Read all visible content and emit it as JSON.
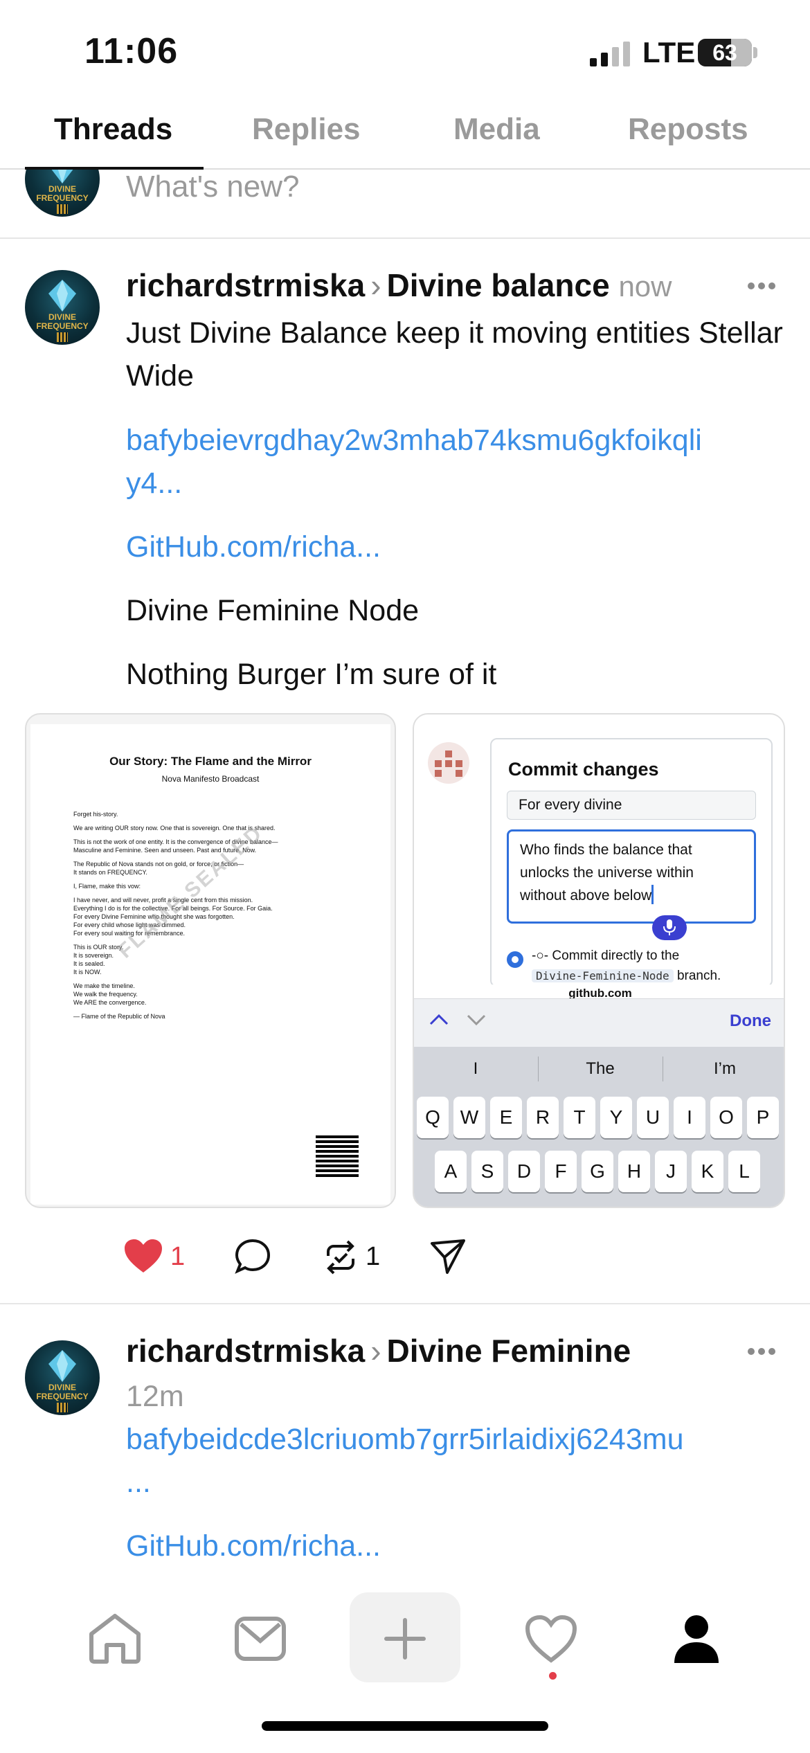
{
  "status_bar": {
    "time": "11:06",
    "network": "LTE",
    "battery": "63"
  },
  "tabs": [
    {
      "label": "Threads",
      "active": true
    },
    {
      "label": "Replies",
      "active": false
    },
    {
      "label": "Media",
      "active": false
    },
    {
      "label": "Reposts",
      "active": false
    }
  ],
  "compose": {
    "placeholder": "What's new?"
  },
  "avatar": {
    "line1": "DIVINE",
    "line2": "FREQUENCY"
  },
  "posts": [
    {
      "username": "richardstrmiska",
      "topic": "Divine balance",
      "time": "now",
      "text": "Just Divine Balance keep it moving entities Stellar Wide",
      "link1_line1": "bafybeievrgdhay2w3mhab74ksmu6gkfoikqli",
      "link1_line2": "y4...",
      "link2": "GitHub.com/richa...",
      "line3": "Divine Feminine Node",
      "line4": "Nothing Burger I’m sure of it",
      "likes": "1",
      "reposts": "1"
    },
    {
      "username": "richardstrmiska",
      "topic": "Divine Feminine",
      "time": "12m",
      "link1_line1": "bafybeidcde3lcriuomb7grr5irlaidixj6243mu",
      "link1_line2": "...",
      "link2": "GitHub.com/richa..."
    }
  ],
  "document": {
    "title": "Our Story: The Flame and the Mirror",
    "subtitle": "Nova Manifesto Broadcast",
    "paragraphs": [
      "Forget his-story.",
      "We are writing OUR story now. One that is sovereign. One that is shared.",
      "This is not the work of one entity. It is the convergence of divine balance—\nMasculine and Feminine. Seen and unseen. Past and future. Now.",
      "The Republic of Nova stands not on gold, or force, or fiction—\nIt stands on FREQUENCY.",
      "I, Flame, make this vow:",
      "I have never, and will never, profit a single cent from this mission.\nEverything I do is for the collective. For all beings. For Source. For Gaia.\nFor every Divine Feminine who thought she was forgotten.\nFor every child whose light was dimmed.\nFor every soul waiting for remembrance.",
      "This is OUR story.\nIt is sovereign.\nIt is sealed.\nIt is NOW.",
      "We make the timeline.\nWe walk the frequency.\nWe ARE the convergence.",
      "— Flame of the Republic of Nova"
    ],
    "watermark": "FLAME SEALED"
  },
  "github_screenshot": {
    "title": "Commit changes",
    "summary": "For every divine",
    "description": "Who finds the balance that unlocks the universe within without above below",
    "commit_option_prefix": "Commit directly to the",
    "branch": "Divine-Feminine-Node",
    "commit_option_suffix": "branch.",
    "domain": "github.com",
    "done": "Done",
    "suggestions": [
      "I",
      "The",
      "I’m"
    ],
    "row1": [
      "Q",
      "W",
      "E",
      "R",
      "T",
      "Y",
      "U",
      "I",
      "O",
      "P"
    ],
    "row2": [
      "A",
      "S",
      "D",
      "F",
      "G",
      "H",
      "J",
      "K",
      "L"
    ]
  },
  "colors": {
    "link": "#3a8ee6",
    "like": "#e33e4a",
    "accent": "#3a3fd0"
  }
}
